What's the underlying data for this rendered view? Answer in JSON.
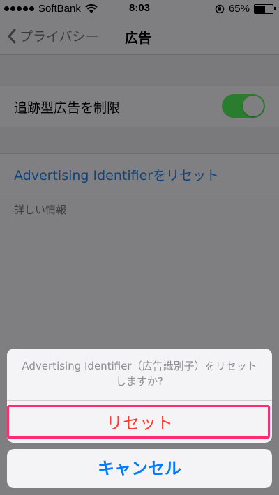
{
  "status_bar": {
    "carrier": "SoftBank",
    "time": "8:03",
    "battery": "65%",
    "battery_level": 0.65
  },
  "nav": {
    "back_label": "プライバシー",
    "title": "広告"
  },
  "settings": {
    "limit_ad_tracking_label": "追跡型広告を制限",
    "limit_ad_tracking_on": true,
    "reset_id_label": "Advertising Identifierをリセット",
    "more_info_label": "詳しい情報"
  },
  "action_sheet": {
    "message": "Advertising Identifier（広告識別子）をリセットしますか?",
    "reset_button": "リセット",
    "cancel_button": "キャンセル"
  },
  "colors": {
    "destructive": "#ff3b30",
    "accent": "#007aff",
    "highlight_border": "#ff2d6f",
    "toggle_on": "#2a7d2e"
  }
}
